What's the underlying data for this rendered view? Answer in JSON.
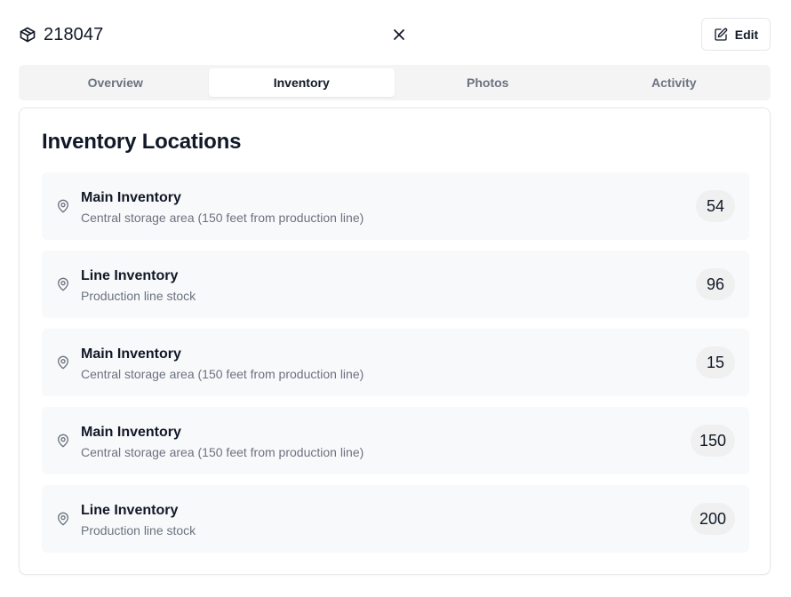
{
  "header": {
    "title": "218047",
    "title_icon": "package-icon",
    "close_icon": "close-icon",
    "edit_label": "Edit",
    "edit_icon": "edit-icon"
  },
  "tabs": [
    {
      "label": "Overview",
      "active": false
    },
    {
      "label": "Inventory",
      "active": true
    },
    {
      "label": "Photos",
      "active": false
    },
    {
      "label": "Activity",
      "active": false
    }
  ],
  "card": {
    "title": "Inventory Locations",
    "locations": [
      {
        "name": "Main Inventory",
        "description": "Central storage area (150 feet from production line)",
        "quantity": "54",
        "icon": "map-pin-icon"
      },
      {
        "name": "Line Inventory",
        "description": "Production line stock",
        "quantity": "96",
        "icon": "map-pin-icon"
      },
      {
        "name": "Main Inventory",
        "description": "Central storage area (150 feet from production line)",
        "quantity": "15",
        "icon": "map-pin-icon"
      },
      {
        "name": "Main Inventory",
        "description": "Central storage area (150 feet from production line)",
        "quantity": "150",
        "icon": "map-pin-icon"
      },
      {
        "name": "Line Inventory",
        "description": "Production line stock",
        "quantity": "200",
        "icon": "map-pin-icon"
      }
    ]
  }
}
